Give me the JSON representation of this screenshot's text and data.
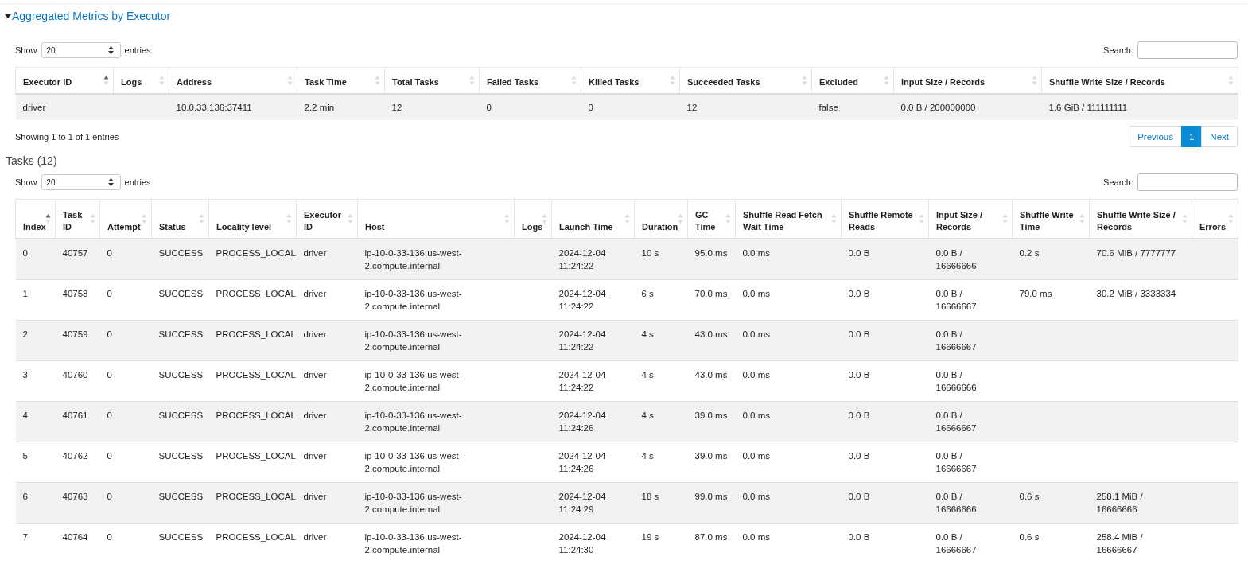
{
  "section": {
    "title": "Aggregated Metrics by Executor",
    "expanded": true
  },
  "executor_table": {
    "length_label_before": "Show",
    "length_value": "20",
    "length_label_after": "entries",
    "search_label": "Search:",
    "columns": [
      {
        "label": "Executor ID",
        "sorted": true
      },
      {
        "label": "Logs",
        "sorted": false
      },
      {
        "label": "Address",
        "sorted": false
      },
      {
        "label": "Task Time",
        "sorted": false
      },
      {
        "label": "Total Tasks",
        "sorted": false
      },
      {
        "label": "Failed Tasks",
        "sorted": false
      },
      {
        "label": "Killed Tasks",
        "sorted": false
      },
      {
        "label": "Succeeded Tasks",
        "sorted": false
      },
      {
        "label": "Excluded",
        "sorted": false
      },
      {
        "label": "Input Size / Records",
        "sorted": false
      },
      {
        "label": "Shuffle Write Size / Records",
        "sorted": false
      }
    ],
    "rows": [
      [
        "driver",
        null,
        "10.0.33.136:37411",
        "2.2 min",
        "12",
        "0",
        "0",
        "12",
        "false",
        "0.0 B / 200000000",
        "1.6 GiB / 111111111"
      ]
    ],
    "info": "Showing 1 to 1 of 1 entries",
    "pagination": [
      {
        "kind": "prev",
        "label": "Previous",
        "selected": false
      },
      {
        "kind": "page",
        "label": "1",
        "selected": true
      },
      {
        "kind": "next",
        "label": "Next",
        "selected": false
      }
    ]
  },
  "tasks_title": "Tasks (12)",
  "tasks_table": {
    "length_label_before": "Show",
    "length_value": "20",
    "length_label_after": "entries",
    "search_label": "Search:",
    "columns": [
      {
        "label": "Index",
        "sorted": true
      },
      {
        "label": "Task ID",
        "sorted": false
      },
      {
        "label": "Attempt",
        "sorted": false
      },
      {
        "label": "Status",
        "sorted": false
      },
      {
        "label": "Locality level",
        "sorted": false
      },
      {
        "label": "Executor ID",
        "sorted": false
      },
      {
        "label": "Host",
        "sorted": false
      },
      {
        "label": "Logs",
        "sorted": false
      },
      {
        "label": "Launch Time",
        "sorted": false
      },
      {
        "label": "Duration",
        "sorted": false
      },
      {
        "label": "GC Time",
        "sorted": false
      },
      {
        "label": "Shuffle Read Fetch Wait Time",
        "sorted": false
      },
      {
        "label": "Shuffle Remote Reads",
        "sorted": false
      },
      {
        "label": "Input Size / Records",
        "sorted": false
      },
      {
        "label": "Shuffle Write Time",
        "sorted": false
      },
      {
        "label": "Shuffle Write Size / Records",
        "sorted": false
      },
      {
        "label": "Errors",
        "sorted": false
      }
    ],
    "rows": [
      [
        "0",
        "40757",
        "0",
        "SUCCESS",
        "PROCESS_LOCAL",
        "driver",
        "ip-10-0-33-136.us-west-2.compute.internal",
        null,
        "2024-12-04 11:24:22",
        "10 s",
        "95.0 ms",
        "0.0 ms",
        "0.0 B",
        "0.0 B / 16666666",
        "0.2 s",
        "70.6 MiB / 7777777",
        null
      ],
      [
        "1",
        "40758",
        "0",
        "SUCCESS",
        "PROCESS_LOCAL",
        "driver",
        "ip-10-0-33-136.us-west-2.compute.internal",
        null,
        "2024-12-04 11:24:22",
        "6 s",
        "70.0 ms",
        "0.0 ms",
        "0.0 B",
        "0.0 B / 16666667",
        "79.0 ms",
        "30.2 MiB / 3333334",
        null
      ],
      [
        "2",
        "40759",
        "0",
        "SUCCESS",
        "PROCESS_LOCAL",
        "driver",
        "ip-10-0-33-136.us-west-2.compute.internal",
        null,
        "2024-12-04 11:24:22",
        "4 s",
        "43.0 ms",
        "0.0 ms",
        "0.0 B",
        "0.0 B / 16666667",
        null,
        null,
        null
      ],
      [
        "3",
        "40760",
        "0",
        "SUCCESS",
        "PROCESS_LOCAL",
        "driver",
        "ip-10-0-33-136.us-west-2.compute.internal",
        null,
        "2024-12-04 11:24:22",
        "4 s",
        "43.0 ms",
        "0.0 ms",
        "0.0 B",
        "0.0 B / 16666666",
        null,
        null,
        null
      ],
      [
        "4",
        "40761",
        "0",
        "SUCCESS",
        "PROCESS_LOCAL",
        "driver",
        "ip-10-0-33-136.us-west-2.compute.internal",
        null,
        "2024-12-04 11:24:26",
        "4 s",
        "39.0 ms",
        "0.0 ms",
        "0.0 B",
        "0.0 B / 16666667",
        null,
        null,
        null
      ],
      [
        "5",
        "40762",
        "0",
        "SUCCESS",
        "PROCESS_LOCAL",
        "driver",
        "ip-10-0-33-136.us-west-2.compute.internal",
        null,
        "2024-12-04 11:24:26",
        "4 s",
        "39.0 ms",
        "0.0 ms",
        "0.0 B",
        "0.0 B / 16666667",
        null,
        null,
        null
      ],
      [
        "6",
        "40763",
        "0",
        "SUCCESS",
        "PROCESS_LOCAL",
        "driver",
        "ip-10-0-33-136.us-west-2.compute.internal",
        null,
        "2024-12-04 11:24:29",
        "18 s",
        "99.0 ms",
        "0.0 ms",
        "0.0 B",
        "0.0 B / 16666666",
        "0.6 s",
        "258.1 MiB / 16666666",
        null
      ],
      [
        "7",
        "40764",
        "0",
        "SUCCESS",
        "PROCESS_LOCAL",
        "driver",
        "ip-10-0-33-136.us-west-2.compute.internal",
        null,
        "2024-12-04 11:24:30",
        "19 s",
        "87.0 ms",
        "0.0 ms",
        "0.0 B",
        "0.0 B / 16666667",
        "0.6 s",
        "258.4 MiB / 16666667",
        null
      ]
    ]
  }
}
